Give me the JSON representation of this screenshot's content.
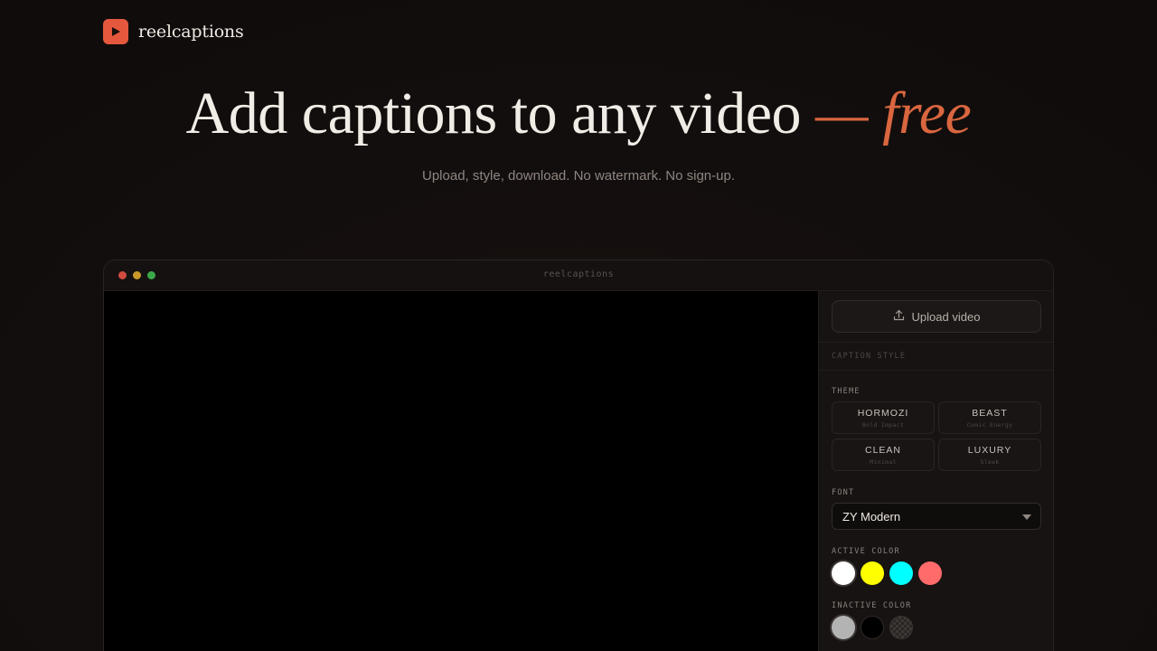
{
  "brand": {
    "name": "reelcaptions"
  },
  "hero": {
    "title_main": "Add captions to any video ",
    "title_accent": "— free",
    "subtitle": "Upload, style, download. No watermark. No sign-up."
  },
  "window": {
    "title": "reelcaptions"
  },
  "panel": {
    "upload_label": "Upload video",
    "section_title": "CAPTION STYLE",
    "theme_label": "THEME",
    "themes": [
      {
        "name": "HORMOZI",
        "desc": "Bold Impact"
      },
      {
        "name": "BEAST",
        "desc": "Comic Energy"
      },
      {
        "name": "CLEAN",
        "desc": "Minimal"
      },
      {
        "name": "LUXURY",
        "desc": "Sleek"
      }
    ],
    "font_label": "FONT",
    "font_value": "ZY Modern",
    "active_color_label": "ACTIVE COLOR",
    "active_colors": [
      "#ffffff",
      "#ffff00",
      "#00ffff",
      "#ff6b6b"
    ],
    "inactive_color_label": "INACTIVE COLOR",
    "inactive_colors": [
      "#b3b3b3",
      "#000000",
      "transparent"
    ]
  },
  "colors": {
    "accent": "#d9663f",
    "brand": "#e5583d",
    "background": "#120e0d"
  }
}
